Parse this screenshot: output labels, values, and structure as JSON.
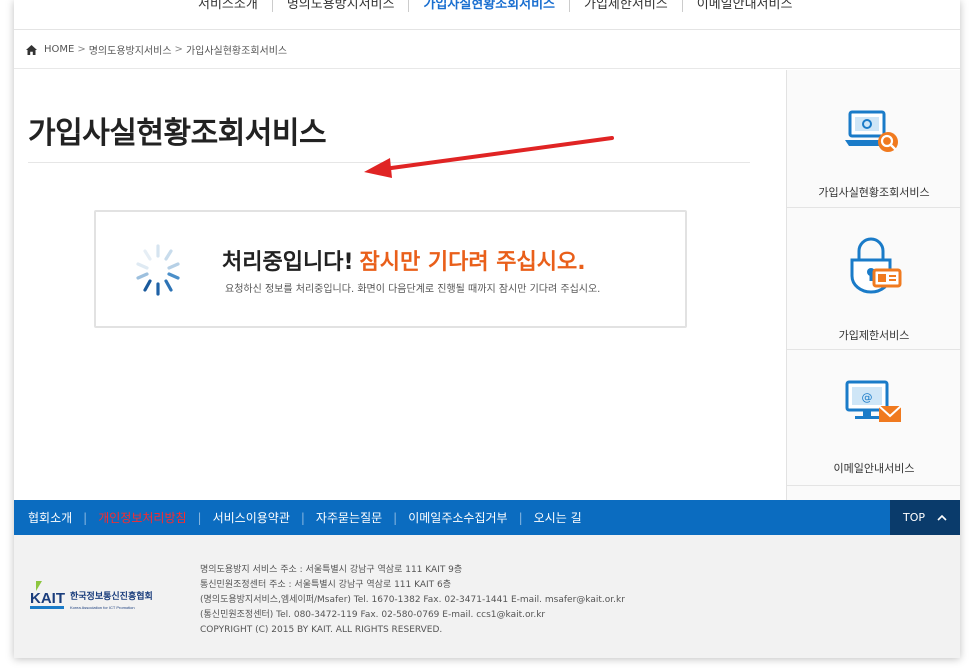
{
  "topnav": {
    "items": [
      {
        "label": "서비스소개",
        "active": false
      },
      {
        "label": "명의도용방지서비스",
        "active": false
      },
      {
        "label": "가입사실현황조회서비스",
        "active": true
      },
      {
        "label": "가입제한서비스",
        "active": false
      },
      {
        "label": "이메일안내서비스",
        "active": false
      }
    ]
  },
  "breadcrumb": {
    "home": "HOME",
    "sep": ">",
    "level1": "명의도용방지서비스",
    "level2": "가입사실현황조회서비스"
  },
  "main": {
    "title": "가입사실현황조회서비스",
    "loading": {
      "headline": "처리중입니다!",
      "headline_accent": "잠시만 기다려 주십시오.",
      "message": "요청하신 정보를 처리중입니다. 화면이 다음단계로 진행될 때까지 잠시만 기다려 주십시오."
    }
  },
  "sidebar": {
    "items": [
      {
        "label": "가입사실현황조회서비스",
        "icon": "laptop-search-icon"
      },
      {
        "label": "가입제한서비스",
        "icon": "lock-id-card-icon"
      },
      {
        "label": "이메일안내서비스",
        "icon": "monitor-mail-icon"
      }
    ]
  },
  "footer_nav": {
    "items": [
      "협회소개",
      "개인정보처리방침",
      "서비스이용약관",
      "자주묻는질문",
      "이메일주소수집거부",
      "오시는 길"
    ],
    "top_label": "TOP"
  },
  "footer": {
    "logo_text": "KAIT",
    "logo_org": "한국정보통신진흥협회",
    "logo_sub": "Korea Association for ICT Promotion",
    "lines": [
      "명의도용방지 서비스 주소 : 서울특별시 강남구 역삼로 111 KAIT 9층",
      "통신민원조정센터 주소 : 서울특별시 강남구 역삼로 111 KAIT 6층",
      "(명의도용방지서비스,엠세이퍼/Msafer) Tel. 1670-1382 Fax. 02-3471-1441 E-mail. msafer@kait.or.kr",
      "(통신민원조정센터) Tel. 080-3472-119 Fax. 02-580-0769 E-mail. ccs1@kait.or.kr",
      "COPYRIGHT (C) 2015 BY KAIT. ALL RIGHTS RESERVED."
    ]
  },
  "colors": {
    "accent_blue": "#0b6cc0",
    "accent_orange": "#e95f1a",
    "annotation_red": "#e02424",
    "top_button": "#0a3b6b"
  }
}
